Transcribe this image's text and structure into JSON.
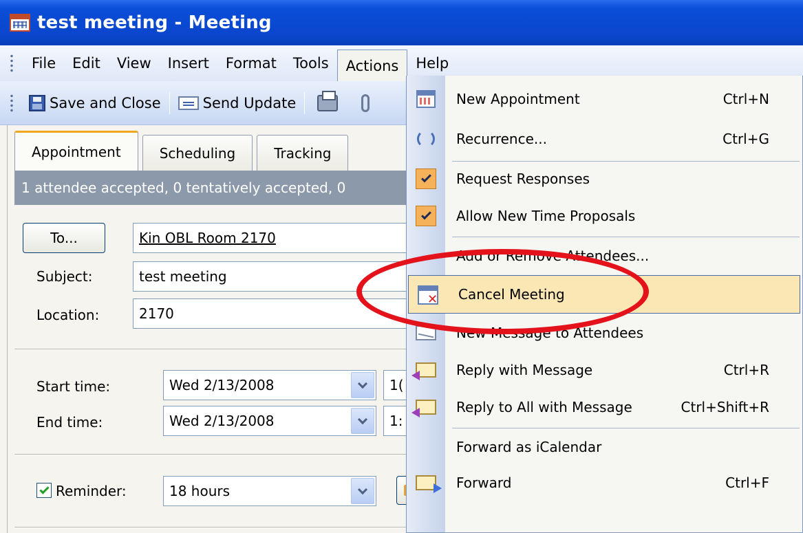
{
  "window": {
    "title": "test meeting - Meeting"
  },
  "menubar": {
    "items": [
      {
        "label": "File"
      },
      {
        "label": "Edit"
      },
      {
        "label": "View"
      },
      {
        "label": "Insert"
      },
      {
        "label": "Format"
      },
      {
        "label": "Tools"
      },
      {
        "label": "Actions"
      },
      {
        "label": "Help"
      }
    ]
  },
  "toolbar": {
    "save_close": "Save and Close",
    "send_update": "Send Update"
  },
  "tabs": [
    {
      "label": "Appointment"
    },
    {
      "label": "Scheduling"
    },
    {
      "label": "Tracking"
    }
  ],
  "infobar": {
    "text": "1 attendee accepted, 0 tentatively accepted, 0"
  },
  "form": {
    "to_button": "To...",
    "to_value": "Kin OBL Room 2170",
    "subject_label": "Subject:",
    "subject_value": "test meeting",
    "location_label": "Location:",
    "location_value": "2170",
    "start_label": "Start time:",
    "start_date": "Wed 2/13/2008",
    "start_time_partial": "1(",
    "end_label": "End time:",
    "end_date": "Wed 2/13/2008",
    "end_time_partial": "1:",
    "reminder_label": "Reminder:",
    "reminder_value": "18 hours",
    "reminder_checked": true
  },
  "actions_menu": {
    "items": [
      {
        "label": "New Appointment",
        "shortcut": "Ctrl+N",
        "icon": "calendar-icon"
      },
      {
        "label": "Recurrence...",
        "shortcut": "Ctrl+G",
        "icon": "recurrence-icon"
      },
      {
        "label": "Request Responses",
        "shortcut": "",
        "icon": "checkmark-icon",
        "checked": true
      },
      {
        "label": "Allow New Time Proposals",
        "shortcut": "",
        "icon": "checkmark-icon",
        "checked": true
      },
      {
        "label": "Add or Remove Attendees...",
        "shortcut": "",
        "icon": ""
      },
      {
        "label": "Cancel Meeting",
        "shortcut": "",
        "icon": "cancel-meeting-icon",
        "highlighted": true
      },
      {
        "label": "New Message to Attendees",
        "shortcut": "",
        "icon": "new-message-icon"
      },
      {
        "label": "Reply with Message",
        "shortcut": "Ctrl+R",
        "icon": "reply-icon"
      },
      {
        "label": "Reply to All with Message",
        "shortcut": "Ctrl+Shift+R",
        "icon": "reply-all-icon"
      },
      {
        "label": "Forward as iCalendar",
        "shortcut": "",
        "icon": ""
      },
      {
        "label": "Forward",
        "shortcut": "Ctrl+F",
        "icon": "forward-icon"
      }
    ]
  },
  "colors": {
    "titlebar": "#0a45cc",
    "highlight": "#fbe7b3",
    "annotation": "#e4121b"
  }
}
